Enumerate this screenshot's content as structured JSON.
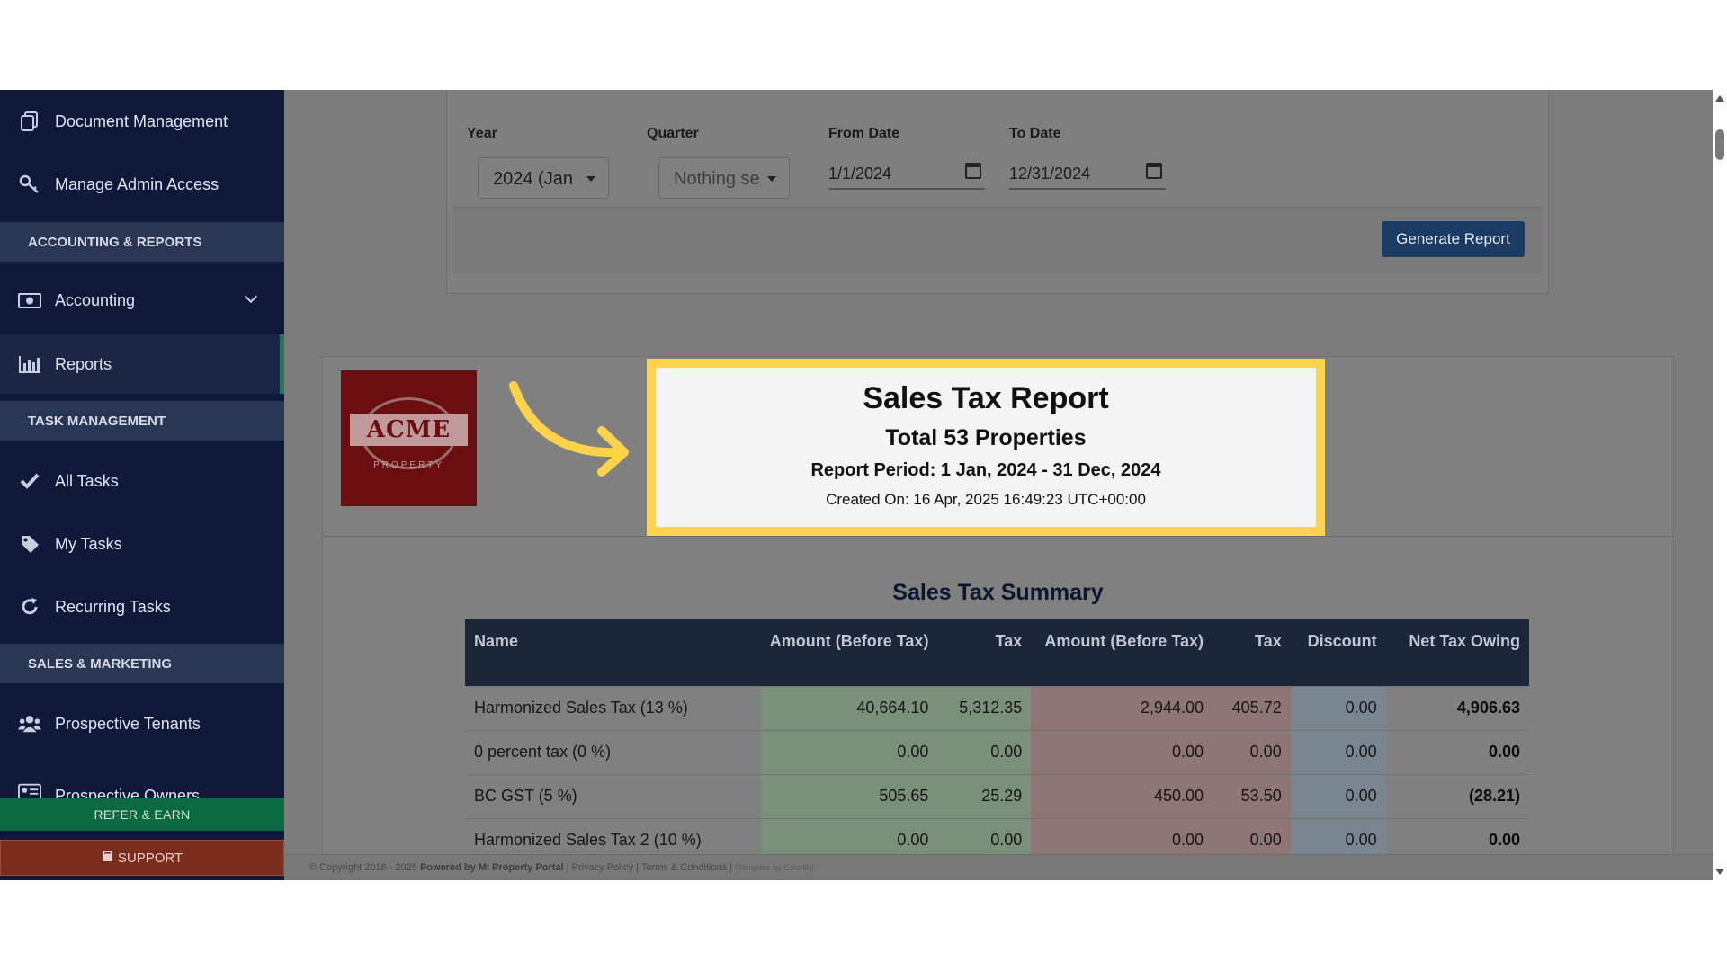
{
  "sidebar": {
    "items_top": [
      {
        "label": "Document Management",
        "icon": "document-copy-icon"
      },
      {
        "label": "Manage Admin Access",
        "icon": "key-icon"
      }
    ],
    "section_accounting": "ACCOUNTING & REPORTS",
    "accounting": {
      "label": "Accounting",
      "icon": "money-icon"
    },
    "reports": {
      "label": "Reports",
      "icon": "bar-chart-icon"
    },
    "section_tasks": "TASK MANAGEMENT",
    "all_tasks": {
      "label": "All Tasks",
      "icon": "check-icon"
    },
    "my_tasks": {
      "label": "My Tasks",
      "icon": "tag-icon"
    },
    "recurring_tasks": {
      "label": "Recurring Tasks",
      "icon": "refresh-icon"
    },
    "section_sales": "SALES & MARKETING",
    "prospective_tenants": {
      "label": "Prospective Tenants",
      "icon": "users-icon"
    },
    "prospective_owners": {
      "label": "Prospective Owners",
      "icon": "id-card-icon"
    },
    "refer_label": "REFER & EARN",
    "support_label": "SUPPORT"
  },
  "filters": {
    "year_label": "Year",
    "year_value": "2024 (Jan",
    "quarter_label": "Quarter",
    "quarter_value": "Nothing se",
    "from_label": "From Date",
    "from_value": "1/1/2024",
    "to_label": "To Date",
    "to_value": "12/31/2024",
    "generate_label": "Generate Report"
  },
  "report": {
    "logo_text": "ACME",
    "logo_subtext": "PROPERTY",
    "title": "Sales Tax Report",
    "properties": "Total 53 Properties",
    "period": "Report Period: 1 Jan, 2024 - 31 Dec, 2024",
    "created": "Created On: 16 Apr, 2025 16:49:23 UTC+00:00",
    "highlight_color": "#fcd34a",
    "summary_title": "Sales Tax Summary",
    "table": {
      "headers": [
        "Name",
        "Amount (Before Tax)",
        "Tax",
        "Amount (Before Tax)",
        "Tax",
        "Discount",
        "Net Tax Owing"
      ],
      "rows": [
        [
          "Harmonized Sales Tax (13 %)",
          "40,664.10",
          "5,312.35",
          "2,944.00",
          "405.72",
          "0.00",
          "4,906.63"
        ],
        [
          "0 percent tax (0 %)",
          "0.00",
          "0.00",
          "0.00",
          "0.00",
          "0.00",
          "0.00"
        ],
        [
          "BC GST (5 %)",
          "505.65",
          "25.29",
          "450.00",
          "53.50",
          "0.00",
          "(28.21)"
        ],
        [
          "Harmonized Sales Tax 2 (10 %)",
          "0.00",
          "0.00",
          "0.00",
          "0.00",
          "0.00",
          "0.00"
        ]
      ]
    }
  },
  "footer": {
    "copyright": "© Copyright 2016 - 2025",
    "powered": "Powered by MI Property Portal",
    "privacy": "Privacy Policy",
    "terms": "Terms & Conditions",
    "template": "(Template by Colorlib)"
  }
}
